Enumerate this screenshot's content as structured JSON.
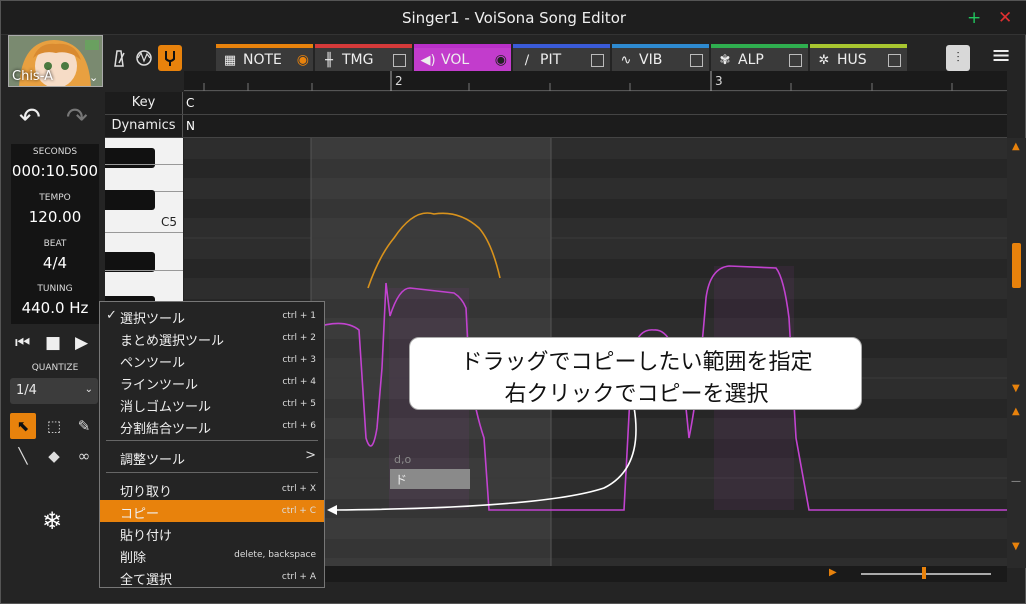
{
  "window": {
    "title": "Singer1 - VoiSona Song Editor",
    "add_symbol": "+",
    "close_symbol": "✕"
  },
  "singer": {
    "name": "Chis-A"
  },
  "param_tabs": [
    {
      "label": "NOTE",
      "icon": "piano-icon"
    },
    {
      "label": "TMG",
      "icon": "timing-icon"
    },
    {
      "label": "VOL",
      "icon": "speaker-icon"
    },
    {
      "label": "PIT",
      "icon": "pitch-icon"
    },
    {
      "label": "VIB",
      "icon": "vibrato-icon"
    },
    {
      "label": "ALP",
      "icon": "alpha-icon"
    },
    {
      "label": "HUS",
      "icon": "husky-icon"
    }
  ],
  "info": {
    "seconds_label": "SECONDS",
    "seconds_value": "000:10.500",
    "tempo_label": "TEMPO",
    "tempo_value": "120.00",
    "beat_label": "BEAT",
    "beat_value": "4/4",
    "tuning_label": "TUNING",
    "tuning_value": "440.0 Hz"
  },
  "quantize": {
    "label": "QUANTIZE",
    "value": "1/4"
  },
  "ruler": {
    "m2": "2",
    "m3": "3"
  },
  "rows": {
    "key_label": "Key",
    "key_value": "C",
    "dyn_label": "Dynamics",
    "dyn_value": "N"
  },
  "keyboard": {
    "c5_label": "C5"
  },
  "note": {
    "phoneme": "d,o",
    "lyric": "ド"
  },
  "context_menu": {
    "check": "✓",
    "items": [
      {
        "label": "選択ツール",
        "shortcut": "ctrl + 1"
      },
      {
        "label": "まとめ選択ツール",
        "shortcut": "ctrl + 2"
      },
      {
        "label": "ペンツール",
        "shortcut": "ctrl + 3"
      },
      {
        "label": "ラインツール",
        "shortcut": "ctrl + 4"
      },
      {
        "label": "消しゴムツール",
        "shortcut": "ctrl + 5"
      },
      {
        "label": "分割結合ツール",
        "shortcut": "ctrl + 6"
      },
      {
        "label": "調整ツール",
        "shortcut": ">"
      },
      {
        "label": "切り取り",
        "shortcut": "ctrl + X"
      },
      {
        "label": "コピー",
        "shortcut": "ctrl + C"
      },
      {
        "label": "貼り付け",
        "shortcut": ""
      },
      {
        "label": "削除",
        "shortcut": "delete, backspace"
      },
      {
        "label": "全て選択",
        "shortcut": "ctrl + A"
      }
    ]
  },
  "callout": {
    "line1": "ドラッグでコピーしたい範囲を指定",
    "line2": "右クリックでコピーを選択"
  }
}
